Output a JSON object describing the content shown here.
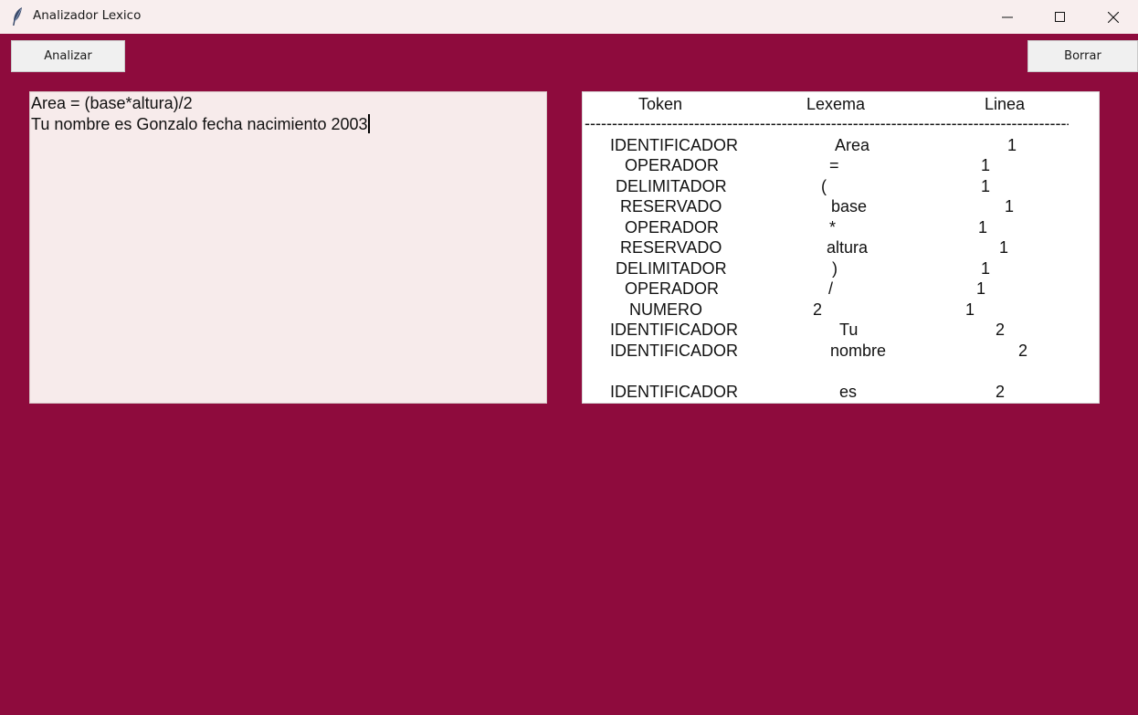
{
  "window": {
    "title": "Analizador Lexico",
    "background": "#8e0b3d",
    "icon": "feather-icon"
  },
  "toolbar": {
    "analizar_label": "Analizar",
    "borrar_label": "Borrar"
  },
  "input": {
    "lines": [
      "Area = (base*altura)/2",
      "Tu nombre es Gonzalo fecha nacimiento 2003"
    ]
  },
  "output": {
    "headers": {
      "token": "Token",
      "lexema": "Lexema",
      "linea": "Linea"
    },
    "divider": "----------------------------------------------------------------------------------------------------------------------------------",
    "rows": [
      {
        "token": "IDENTIFICADOR",
        "lexema": "Area",
        "linea": "1"
      },
      {
        "token": "OPERADOR",
        "lexema": "=",
        "linea": "1"
      },
      {
        "token": "DELIMITADOR",
        "lexema": "(",
        "linea": "1"
      },
      {
        "token": "RESERVADO",
        "lexema": "base",
        "linea": "1"
      },
      {
        "token": "OPERADOR",
        "lexema": "*",
        "linea": "1"
      },
      {
        "token": "RESERVADO",
        "lexema": "altura",
        "linea": "1"
      },
      {
        "token": "DELIMITADOR",
        "lexema": ")",
        "linea": "1"
      },
      {
        "token": "OPERADOR",
        "lexema": "/",
        "linea": "1"
      },
      {
        "token": "NUMERO",
        "lexema": "2",
        "linea": "1"
      },
      {
        "token": "IDENTIFICADOR",
        "lexema": "Tu",
        "linea": "2"
      },
      {
        "token": "IDENTIFICADOR",
        "lexema": "nombre",
        "linea": "2"
      },
      {
        "token": "",
        "lexema": "",
        "linea": ""
      },
      {
        "token": "IDENTIFICADOR",
        "lexema": "es",
        "linea": "2"
      }
    ]
  }
}
